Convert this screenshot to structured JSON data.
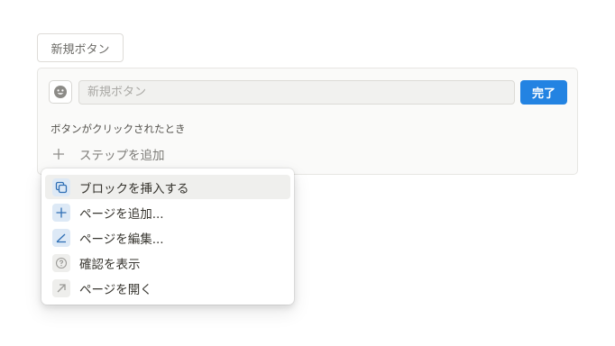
{
  "button_chip": {
    "label": "新規ボタン"
  },
  "editor": {
    "name_placeholder": "新規ボタン",
    "done_label": "完了",
    "trigger_label": "ボタンがクリックされたとき",
    "add_step_label": "ステップを追加"
  },
  "menu": {
    "items": [
      {
        "label": "ブロックを挿入する",
        "icon": "copy-block-icon",
        "icon_color": "blue"
      },
      {
        "label": "ページを追加...",
        "icon": "plus-icon",
        "icon_color": "blue"
      },
      {
        "label": "ページを編集...",
        "icon": "edit-angle-icon",
        "icon_color": "blue"
      },
      {
        "label": "確認を表示",
        "icon": "question-circle-icon",
        "icon_color": "grey"
      },
      {
        "label": "ページを開く",
        "icon": "arrow-up-right-icon",
        "icon_color": "grey"
      }
    ],
    "highlighted_index": 0
  },
  "colors": {
    "accent": "#2383e2",
    "icon_blue": "#2f6fb5",
    "icon_grey": "#9b9a97"
  }
}
